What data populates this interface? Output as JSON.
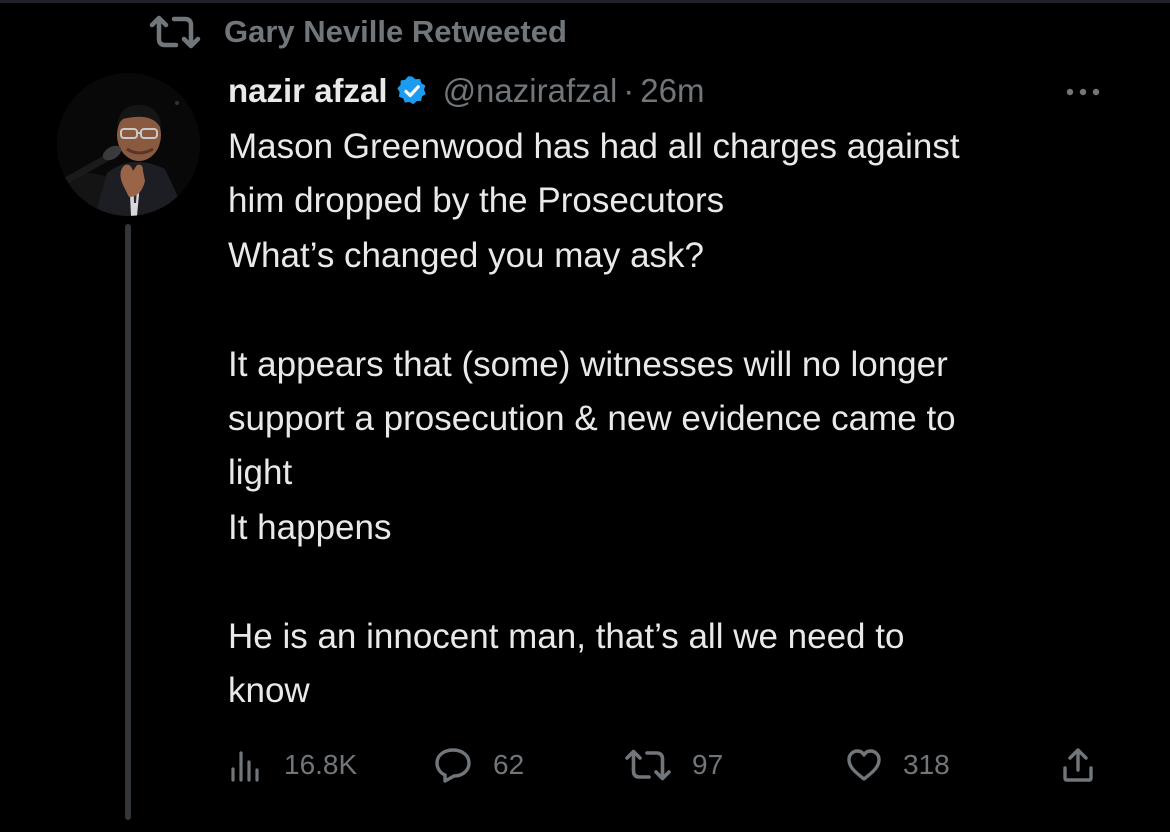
{
  "retweet": {
    "label": "Gary Neville Retweeted",
    "icon": "retweet-icon"
  },
  "tweet": {
    "author": {
      "display_name": "nazir afzal",
      "verified": true,
      "handle": "@nazirafzal",
      "separator": "·",
      "time": "26m",
      "avatar": "avatar-photo"
    },
    "text": "Mason Greenwood has had all charges against\nhim dropped by the Prosecutors\nWhat’s changed you may ask?\n\nIt appears that (some) witnesses will no longer\nsupport a prosecution & new evidence came to\nlight\nIt happens\n\nHe is an innocent man, that’s all we need to\nknow",
    "actions": {
      "views": {
        "icon": "views-icon",
        "count": "16.8K"
      },
      "reply": {
        "icon": "reply-icon",
        "count": "62"
      },
      "retweet": {
        "icon": "retweet-icon",
        "count": "97"
      },
      "like": {
        "icon": "heart-icon",
        "count": "318"
      },
      "share": {
        "icon": "share-icon"
      }
    }
  },
  "colors": {
    "background": "#000000",
    "text_primary": "#e7e9ea",
    "text_secondary": "#71767b",
    "verified_blue": "#1d9bf0",
    "thread_line": "#333639"
  }
}
